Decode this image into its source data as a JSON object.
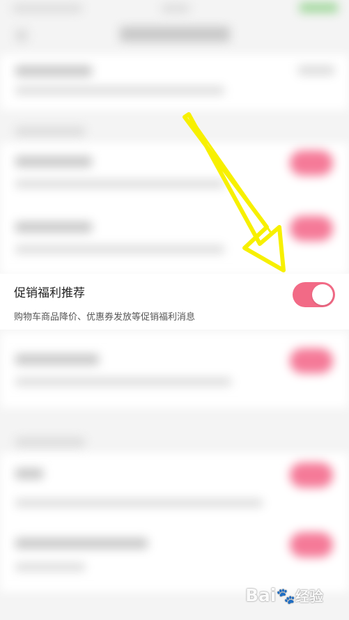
{
  "setting": {
    "title": "促销福利推荐",
    "description": "购物车商品降价、优惠券发放等促销福利消息",
    "enabled": true
  },
  "watermark": {
    "brand": "Bai",
    "suffix": "经验"
  },
  "colors": {
    "toggle_on": "#f26a86",
    "arrow": "#f7f000",
    "background": "#f4f4f4"
  }
}
